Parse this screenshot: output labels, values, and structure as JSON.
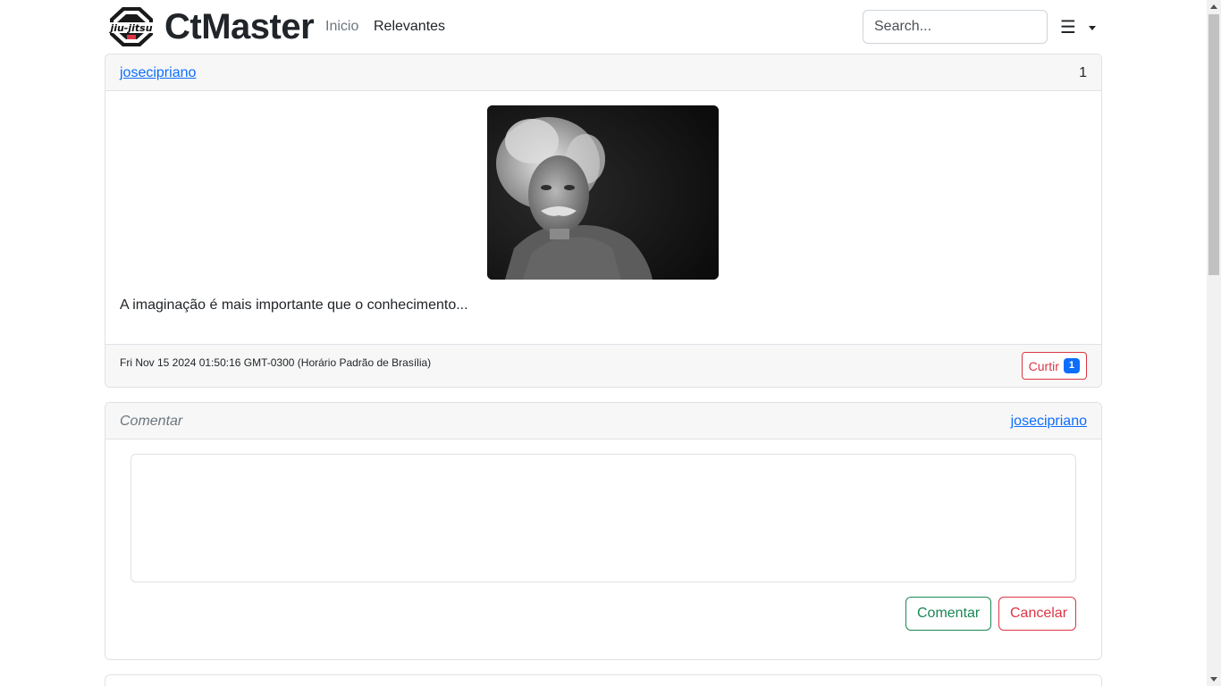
{
  "navbar": {
    "brand_name": "CtMaster",
    "logo_text": "jiu-jitsu",
    "links": [
      {
        "label": "Inicio",
        "active": false
      },
      {
        "label": "Relevantes",
        "active": true
      }
    ],
    "search_placeholder": "Search...",
    "menu_icon": "hamburger-icon"
  },
  "post": {
    "author": "josecipriano",
    "count": "1",
    "image_alt": "Albert Einstein portrait",
    "text": "A imaginação é mais importante que o conhecimento...",
    "timestamp": "Fri Nov 15 2024 01:50:16 GMT-0300 (Horário Padrão de Brasília)",
    "like_label": "Curtir",
    "like_count": "1"
  },
  "comment": {
    "label": "Comentar",
    "user": "josecipriano",
    "textarea_value": "",
    "submit_label": "Comentar",
    "cancel_label": "Cancelar"
  },
  "colors": {
    "primary": "#0d6efd",
    "success": "#198754",
    "danger": "#dc3545",
    "muted": "#6c757d"
  }
}
